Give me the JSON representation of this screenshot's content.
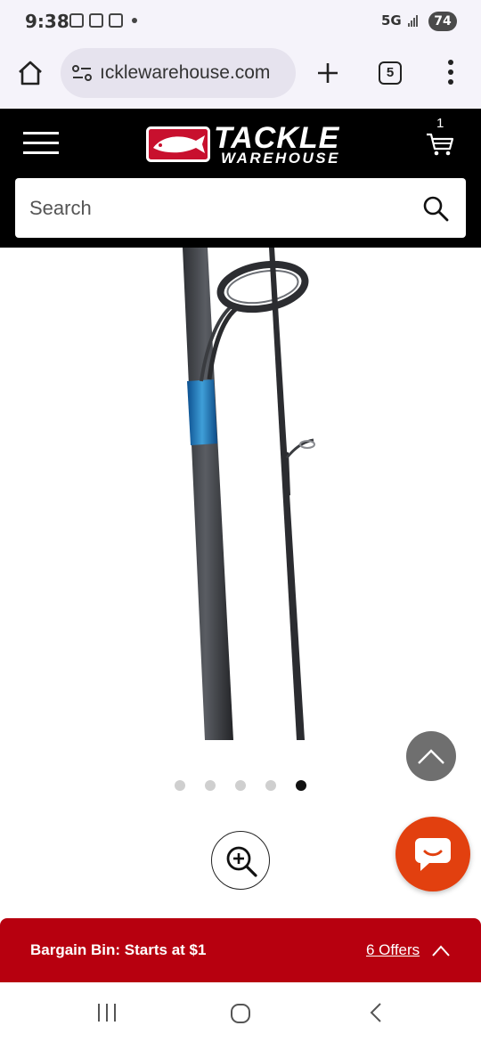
{
  "status_bar": {
    "time": "9:38",
    "network": "5G",
    "battery": "74"
  },
  "browser": {
    "url": "ackewarehouse.com",
    "url_display": "ıcklewarehouse.com",
    "tab_count": "5",
    "icons": [
      "home-icon",
      "site-settings-icon",
      "new-tab-icon",
      "tab-switcher-icon",
      "menu-dots-icon"
    ]
  },
  "header": {
    "logo_line1": "TACKLE",
    "logo_line2": "WAREHOUSE",
    "cart_count": "1",
    "brand_color": "#c8102e"
  },
  "search": {
    "placeholder": "Search"
  },
  "carousel": {
    "total_slides": 5,
    "active_index": 5
  },
  "bargain_bin": {
    "label": "Bargain Bin: Starts at $1",
    "offers_link": "6 Offers",
    "color": "#b7000f"
  },
  "chat": {
    "color": "#e2400f"
  }
}
